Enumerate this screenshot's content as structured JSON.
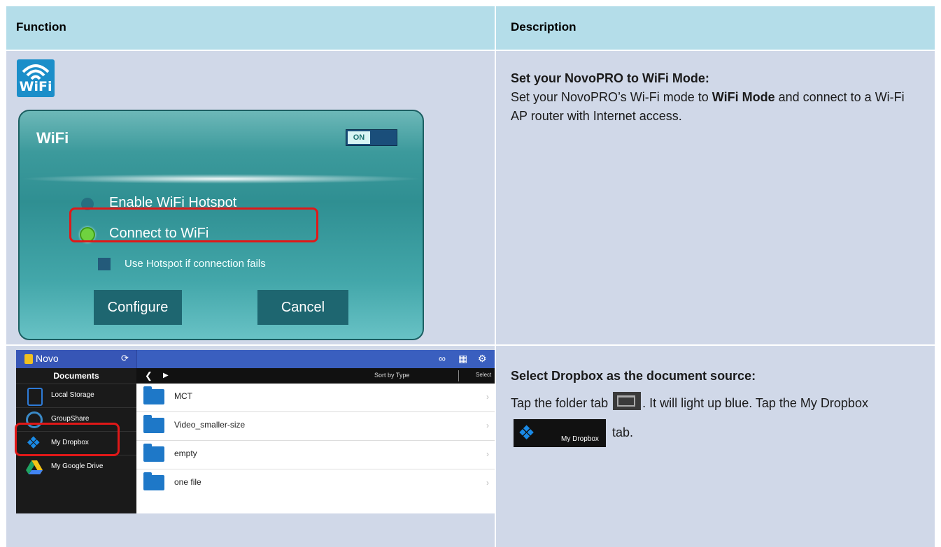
{
  "table": {
    "headers": {
      "function": "Function",
      "description": "Description"
    }
  },
  "row1": {
    "wifi_icon_text": "WiFi",
    "dialog": {
      "title": "WiFi",
      "toggle": "ON",
      "option_hotspot": "Enable WiFi Hotspot",
      "option_connect": "Connect to WiFi",
      "checkbox_label": "Use Hotspot if connection fails",
      "configure_button": "Configure",
      "cancel_button": "Cancel"
    },
    "desc": {
      "title": "Set your NovoPRO to WiFi Mode:",
      "text1": "Set your NovoPRO’s Wi-Fi mode to ",
      "bold": "WiFi Mode",
      "text2": " and connect to a Wi-Fi AP router with Internet access."
    }
  },
  "row2": {
    "browser": {
      "app_name": "Novo",
      "side_header": "Documents",
      "sidebar_items": [
        "Local Storage",
        "GroupShare",
        "My Dropbox",
        "My Google Drive"
      ],
      "sort_label": "Sort by Type",
      "select_label": "Select",
      "files": [
        "MCT",
        "Video_smaller-size",
        "empty",
        "one file"
      ]
    },
    "desc": {
      "title": "Select Dropbox as the document source:",
      "text1": "Tap the folder tab",
      "text2": ". It will light up blue. Tap the My Dropbox",
      "dropbox_label": "My Dropbox",
      "text3": "tab."
    }
  },
  "colors": {
    "header_bg": "#b4dde9",
    "row_bg": "#d0d8e8",
    "highlight": "#e01818",
    "dialog_teal": "#3c9a9c"
  }
}
